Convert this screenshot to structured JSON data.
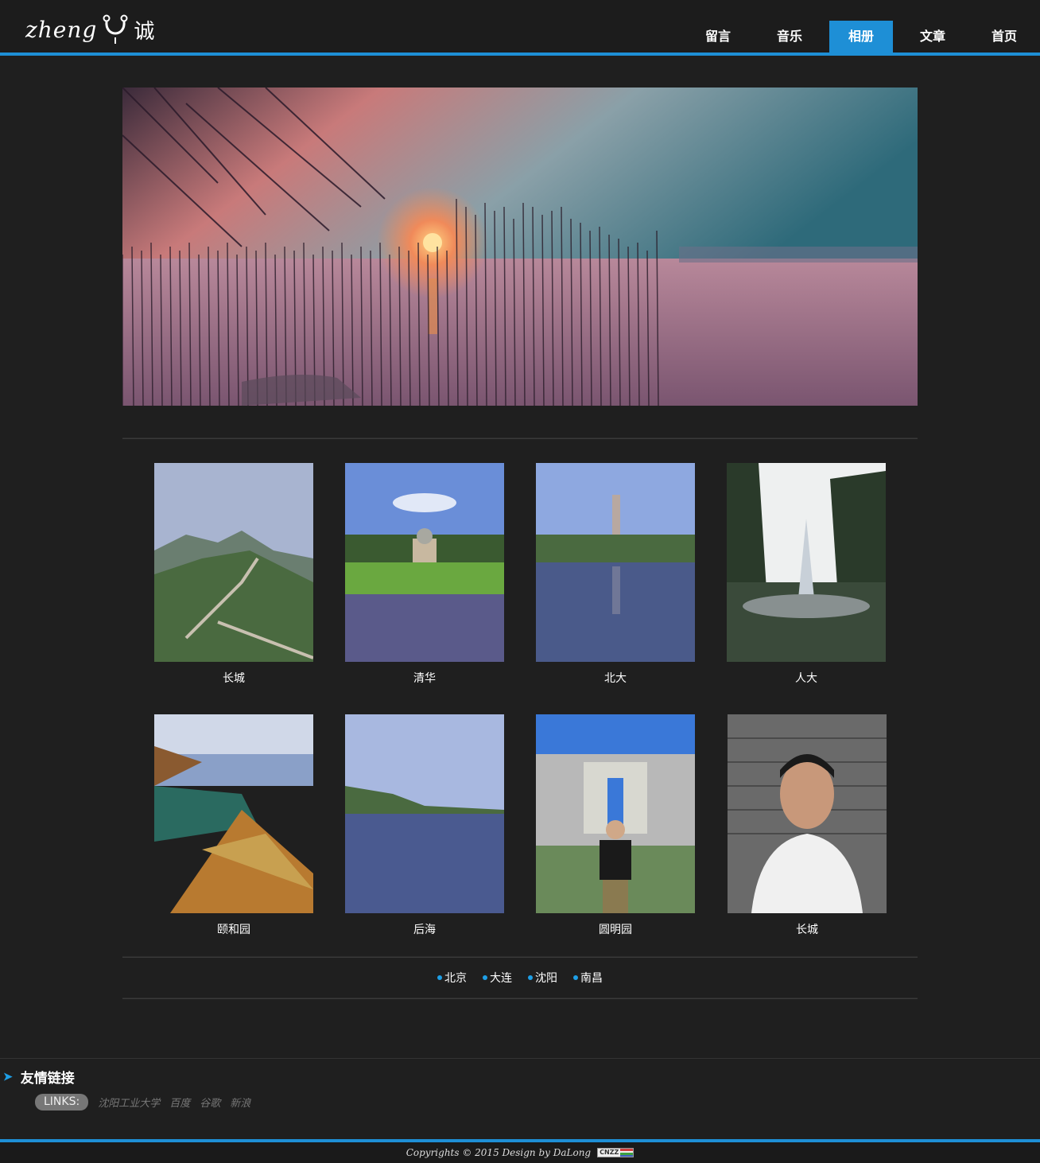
{
  "header": {
    "logo_latin": "zheng",
    "logo_cn": "诚",
    "nav": [
      {
        "label": "留言",
        "active": false
      },
      {
        "label": "音乐",
        "active": false
      },
      {
        "label": "相册",
        "active": true
      },
      {
        "label": "文章",
        "active": false
      },
      {
        "label": "首页",
        "active": false
      }
    ]
  },
  "gallery": {
    "photos": [
      {
        "caption": "长城"
      },
      {
        "caption": "清华"
      },
      {
        "caption": "北大"
      },
      {
        "caption": "人大"
      },
      {
        "caption": "颐和园"
      },
      {
        "caption": "后海"
      },
      {
        "caption": "圆明园"
      },
      {
        "caption": "长城"
      }
    ]
  },
  "cities": [
    "北京",
    "大连",
    "沈阳",
    "南昌"
  ],
  "friend_links": {
    "title": "友情链接",
    "label": "LINKS:",
    "items": [
      "沈阳工业大学",
      "百度",
      "谷歌",
      "新浪"
    ]
  },
  "footer": {
    "copyright": "Copyrights © 2015 Design by DaLong",
    "badge": "CNZZ"
  },
  "colors": {
    "accent": "#1e8fd6",
    "background": "#1f1f1f"
  }
}
